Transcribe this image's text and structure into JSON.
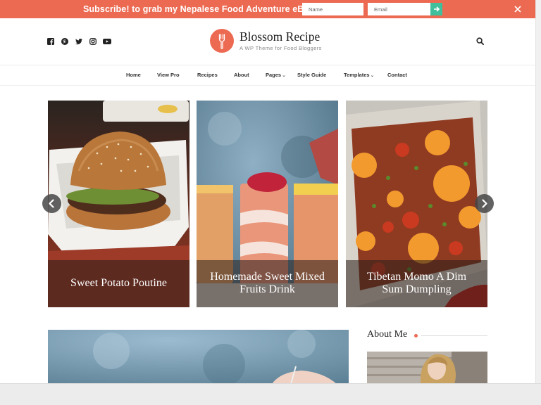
{
  "subscribe_bar": {
    "message": "Subscribe! to grab my Nepalese Food Adventure eBook!",
    "name_placeholder": "Name",
    "email_placeholder": "Email",
    "submit_icon": "arrow-right-icon",
    "close_icon": "close-icon"
  },
  "header": {
    "social_icons": [
      "facebook-icon",
      "pinterest-icon",
      "twitter-icon",
      "instagram-icon",
      "youtube-icon"
    ],
    "site_title": "Blossom Recipe",
    "tagline": "A WP Theme for Food Bloggers",
    "logo_icon": "fork-icon",
    "search_icon": "search-icon"
  },
  "nav": {
    "items": [
      {
        "label": "Home"
      },
      {
        "label": "View Pro"
      },
      {
        "label": "Recipes"
      },
      {
        "label": "About"
      },
      {
        "label": "Pages",
        "has_dropdown": true
      },
      {
        "label": "Style Guide"
      },
      {
        "label": "Templates",
        "has_dropdown": true
      },
      {
        "label": "Contact"
      }
    ]
  },
  "slider": {
    "slides": [
      {
        "title": "Sweet Potato Poutine"
      },
      {
        "title": "Homemade Sweet Mixed Fruits Drink"
      },
      {
        "title": "Tibetan Momo A Dim Sum Dumpling"
      }
    ],
    "prev_icon": "chevron-left-icon",
    "next_icon": "chevron-right-icon"
  },
  "sidebar": {
    "about_title": "About Me"
  },
  "colors": {
    "accent": "#ec6a52",
    "submit": "#3fbf9b"
  }
}
